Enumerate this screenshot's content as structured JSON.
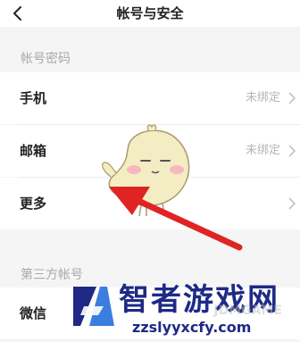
{
  "header": {
    "title": "帐号与安全",
    "back_icon": "chevron-left-icon"
  },
  "sections": [
    {
      "label": "帐号密码",
      "rows": [
        {
          "label": "手机",
          "value": "未绑定"
        },
        {
          "label": "邮箱",
          "value": "未绑定"
        },
        {
          "label": "更多",
          "value": ""
        }
      ]
    },
    {
      "label": "第三方帐号",
      "rows": [
        {
          "label": "微信",
          "value": ""
        }
      ]
    }
  ],
  "watermark": {
    "name": "智者游戏网",
    "url": "zzslyyxcfy.com",
    "ghost": "JDMGAME"
  },
  "annotation": {
    "arrow_color": "#e02424"
  }
}
